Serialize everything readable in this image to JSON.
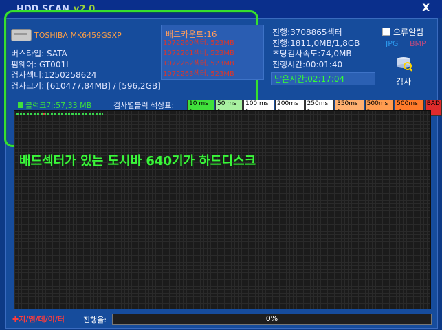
{
  "titlebar": {
    "title": "HDD SCAN",
    "version": "v2.0",
    "close_label": "X"
  },
  "disk": {
    "model": "TOSHIBA MK6459GSXP",
    "bus": "버스타입: SATA",
    "firmware": "펌웨어: GT001L",
    "sectors": "검사섹터:1250258624",
    "size": "검사크기: [610477,84MB] / [596,2GB]"
  },
  "bad": {
    "title": "배드카운트:16",
    "items": [
      "1072260섹터, 523MB",
      "1072261섹터, 523MB",
      "1072262섹터, 523MB",
      "1072263섹터, 523MB"
    ]
  },
  "status": {
    "progress_sectors": "진행:3708865섹터",
    "progress_size": "진행:1811,0MB/1,8GB",
    "speed": "초당검사속도:74,0MB",
    "elapsed": "진행시간:00:01:40",
    "remaining": "남은시간:02:17:04"
  },
  "alarm": {
    "label": "오류알림",
    "jpg": "JPG",
    "bmp": "BMP",
    "scan_label": "검사"
  },
  "blocksize": "블럭크기:57,33 MB",
  "legend_label": "검사별블럭 색상표:",
  "legend": [
    {
      "label": "10 ms >",
      "color": "#40e03b"
    },
    {
      "label": "50 ms >",
      "color": "#a8f0a0"
    },
    {
      "label": "100 ms >",
      "color": "#ffffff"
    },
    {
      "label": "200ms >",
      "color": "#ffffff"
    },
    {
      "label": "250ms >",
      "color": "#ffffff"
    },
    {
      "label": "350ms >",
      "color": "#ffb070"
    },
    {
      "label": "500ms >",
      "color": "#ff9c50"
    },
    {
      "label": "500ms <",
      "color": "#ff7a2a"
    },
    {
      "label": "BAD",
      "color": "#e02b2b"
    }
  ],
  "annotation": "배드섹터가 있는 도시바 640기가 하드디스크",
  "footer": {
    "brand": "✚지/엠/데/이/터",
    "progress_label": "진행율:",
    "progress_value": "0%",
    "progress_fraction": 0
  }
}
